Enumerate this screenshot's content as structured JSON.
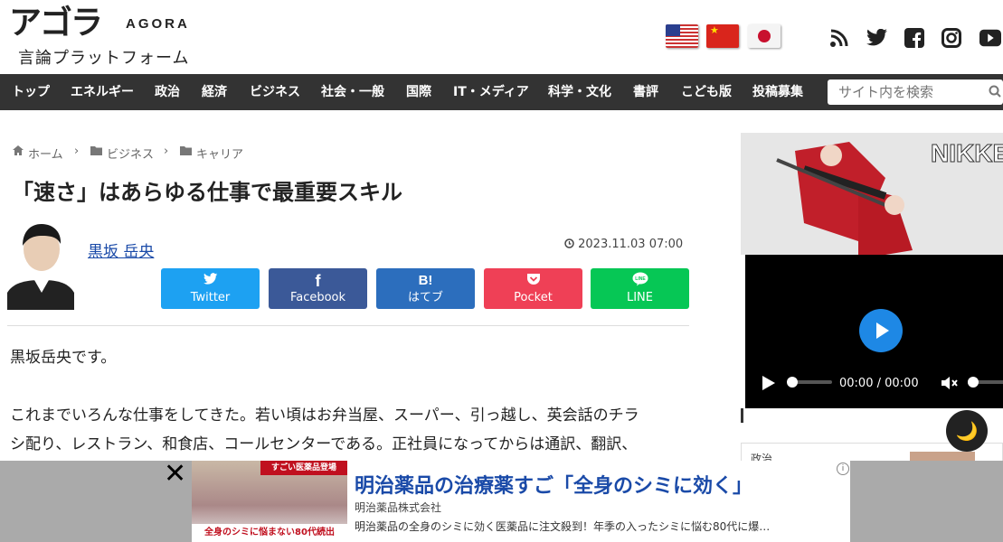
{
  "header": {
    "logo_jp": "アゴラ",
    "logo_en": "AGORA",
    "tagline": "言論プラットフォーム"
  },
  "flags": [
    "us-flag-icon",
    "china-flag-icon",
    "japan-flag-icon"
  ],
  "social_icons": [
    "rss-icon",
    "twitter-icon",
    "facebook-icon",
    "instagram-icon",
    "youtube-icon"
  ],
  "nav": {
    "items": [
      "トップ",
      "エネルギー",
      "政治",
      "経済",
      "ビジネス",
      "社会・一般",
      "国際",
      "IT・メディア",
      "科学・文化",
      "書評",
      "こども版",
      "投稿募集"
    ],
    "search_placeholder": "サイト内を検索"
  },
  "breadcrumb": [
    "ホーム",
    "ビジネス",
    "キャリア"
  ],
  "article": {
    "title": "「速さ」はあらゆる仕事で最重要スキル",
    "author": "黒坂 岳央",
    "date": "2023.11.03 07:00",
    "share": [
      {
        "icon": "t",
        "label": "Twitter",
        "color": "#1da1f2"
      },
      {
        "icon": "f",
        "label": "Facebook",
        "color": "#3b5998"
      },
      {
        "icon": "B!",
        "label": "はてブ",
        "color": "#2c6ebd"
      },
      {
        "icon": "◡",
        "label": "Pocket",
        "color": "#ef4056"
      },
      {
        "icon": "LINE",
        "label": "LINE",
        "color": "#06c755"
      }
    ],
    "paragraphs": [
      "黒坂岳央です。",
      "これまでいろんな仕事をしてきた。若い頃はお弁当屋、スーパー、引っ越し、英会話のチラ",
      "シ配り、レストラン、和食店、コールセンターである。正社員になってからは通訳、翻訳、"
    ]
  },
  "sidebar": {
    "banner_text": "NIKKE",
    "video": {
      "time_current": "00:00",
      "time_total": "00:00"
    },
    "box_label": "政治"
  },
  "ad": {
    "title": "明治薬品の治療薬すご「全身のシミに効く」",
    "advertiser": "明治薬品株式会社",
    "description": "明治薬品の全身のシミに効く医薬品に注文殺到！年季の入ったシミに悩む80代に爆…",
    "img_badge": "すごい医薬品登場",
    "img_caption": "全身のシミに悩まない80代続出"
  }
}
